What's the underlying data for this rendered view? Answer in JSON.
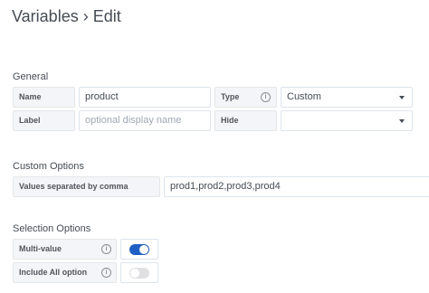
{
  "page": {
    "title": "Variables › Edit"
  },
  "general": {
    "heading": "General",
    "name_label": "Name",
    "name_value": "product",
    "type_label": "Type",
    "type_value": "Custom",
    "label_label": "Label",
    "label_placeholder": "optional display name",
    "hide_label": "Hide",
    "hide_value": ""
  },
  "custom_options": {
    "heading": "Custom Options",
    "values_label": "Values separated by comma",
    "values_value": "prod1,prod2,prod3,prod4"
  },
  "selection_options": {
    "heading": "Selection Options",
    "multi_value_label": "Multi-value",
    "multi_value_enabled": true,
    "include_all_label": "Include All option",
    "include_all_enabled": false
  },
  "colors": {
    "toggle_on": "#1f60c4",
    "toggle_off": "#e0e0e3"
  },
  "icons": {
    "info": "info-circle-icon",
    "dropdown": "caret-down-icon"
  }
}
